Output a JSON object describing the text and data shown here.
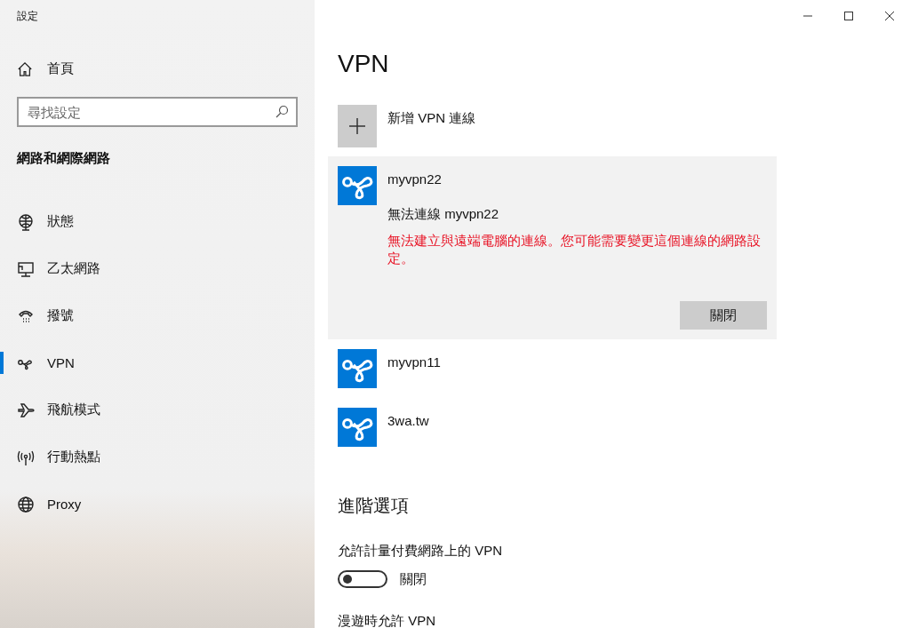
{
  "window": {
    "title": "設定"
  },
  "sidebar": {
    "home": "首頁",
    "search": {
      "placeholder": "尋找設定"
    },
    "section": "網路和網際網路",
    "items": [
      {
        "label": "狀態",
        "selected": false
      },
      {
        "label": "乙太網路",
        "selected": false
      },
      {
        "label": "撥號",
        "selected": false
      },
      {
        "label": "VPN",
        "selected": true
      },
      {
        "label": "飛航模式",
        "selected": false
      },
      {
        "label": "行動熱點",
        "selected": false
      },
      {
        "label": "Proxy",
        "selected": false
      }
    ]
  },
  "main": {
    "title": "VPN",
    "add_label": "新增 VPN 連線",
    "connections": [
      {
        "name": "myvpn22",
        "expanded": true,
        "status": "無法連線 myvpn22",
        "error": "無法建立與遠端電腦的連線。您可能需要變更這個連線的網路設定。",
        "button": "關閉"
      },
      {
        "name": "myvpn11",
        "expanded": false
      },
      {
        "name": "3wa.tw",
        "expanded": false
      }
    ],
    "advanced": {
      "title": "進階選項",
      "settings": [
        {
          "label": "允許計量付費網路上的 VPN",
          "kind": "toggle",
          "on": false,
          "state_text": "關閉"
        },
        {
          "label": "漫遊時允許 VPN",
          "kind": "label"
        }
      ]
    }
  }
}
